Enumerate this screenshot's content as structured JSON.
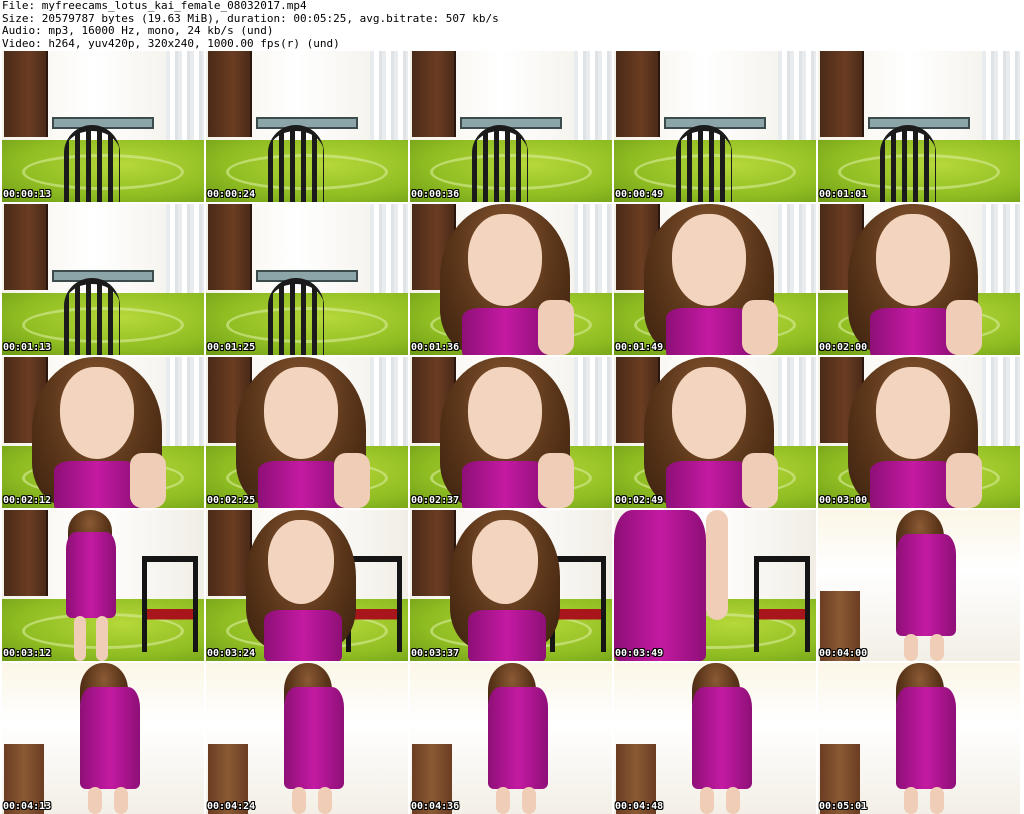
{
  "header": {
    "file_line": "File: myfreecams_lotus_kai_female_08032017.mp4",
    "size_line": "Size: 20579787 bytes (19.63 MiB), duration: 00:05:25, avg.bitrate: 507 kb/s",
    "audio_line": "Audio: mp3, 16000 Hz, mono, 24 kb/s (und)",
    "video_line": "Video: h264, yuv420p, 320x240, 1000.00 fps(r) (und)"
  },
  "thumbnails": [
    {
      "timestamp": "00:00:13",
      "scene": "empty-room"
    },
    {
      "timestamp": "00:00:24",
      "scene": "empty-room"
    },
    {
      "timestamp": "00:00:36",
      "scene": "empty-room"
    },
    {
      "timestamp": "00:00:49",
      "scene": "empty-room"
    },
    {
      "timestamp": "00:01:01",
      "scene": "empty-room"
    },
    {
      "timestamp": "00:01:13",
      "scene": "empty-room"
    },
    {
      "timestamp": "00:01:25",
      "scene": "empty-room"
    },
    {
      "timestamp": "00:01:36",
      "scene": "closeup"
    },
    {
      "timestamp": "00:01:49",
      "scene": "closeup"
    },
    {
      "timestamp": "00:02:00",
      "scene": "closeup"
    },
    {
      "timestamp": "00:02:12",
      "scene": "closeup"
    },
    {
      "timestamp": "00:02:25",
      "scene": "closeup"
    },
    {
      "timestamp": "00:02:37",
      "scene": "closeup"
    },
    {
      "timestamp": "00:02:49",
      "scene": "closeup"
    },
    {
      "timestamp": "00:03:00",
      "scene": "closeup"
    },
    {
      "timestamp": "00:03:12",
      "scene": "standing"
    },
    {
      "timestamp": "00:03:24",
      "scene": "closeup-chair"
    },
    {
      "timestamp": "00:03:37",
      "scene": "closeup-chair"
    },
    {
      "timestamp": "00:03:49",
      "scene": "torso-chair"
    },
    {
      "timestamp": "00:04:00",
      "scene": "bright-standing"
    },
    {
      "timestamp": "00:04:13",
      "scene": "bright-standing"
    },
    {
      "timestamp": "00:04:24",
      "scene": "bright-standing"
    },
    {
      "timestamp": "00:04:36",
      "scene": "bright-standing"
    },
    {
      "timestamp": "00:04:48",
      "scene": "bright-standing"
    },
    {
      "timestamp": "00:05:01",
      "scene": "bright-standing"
    }
  ],
  "colors": {
    "dress": "#c41aa3",
    "floor": "#8fbd22",
    "stamp_text": "#ffffff"
  }
}
